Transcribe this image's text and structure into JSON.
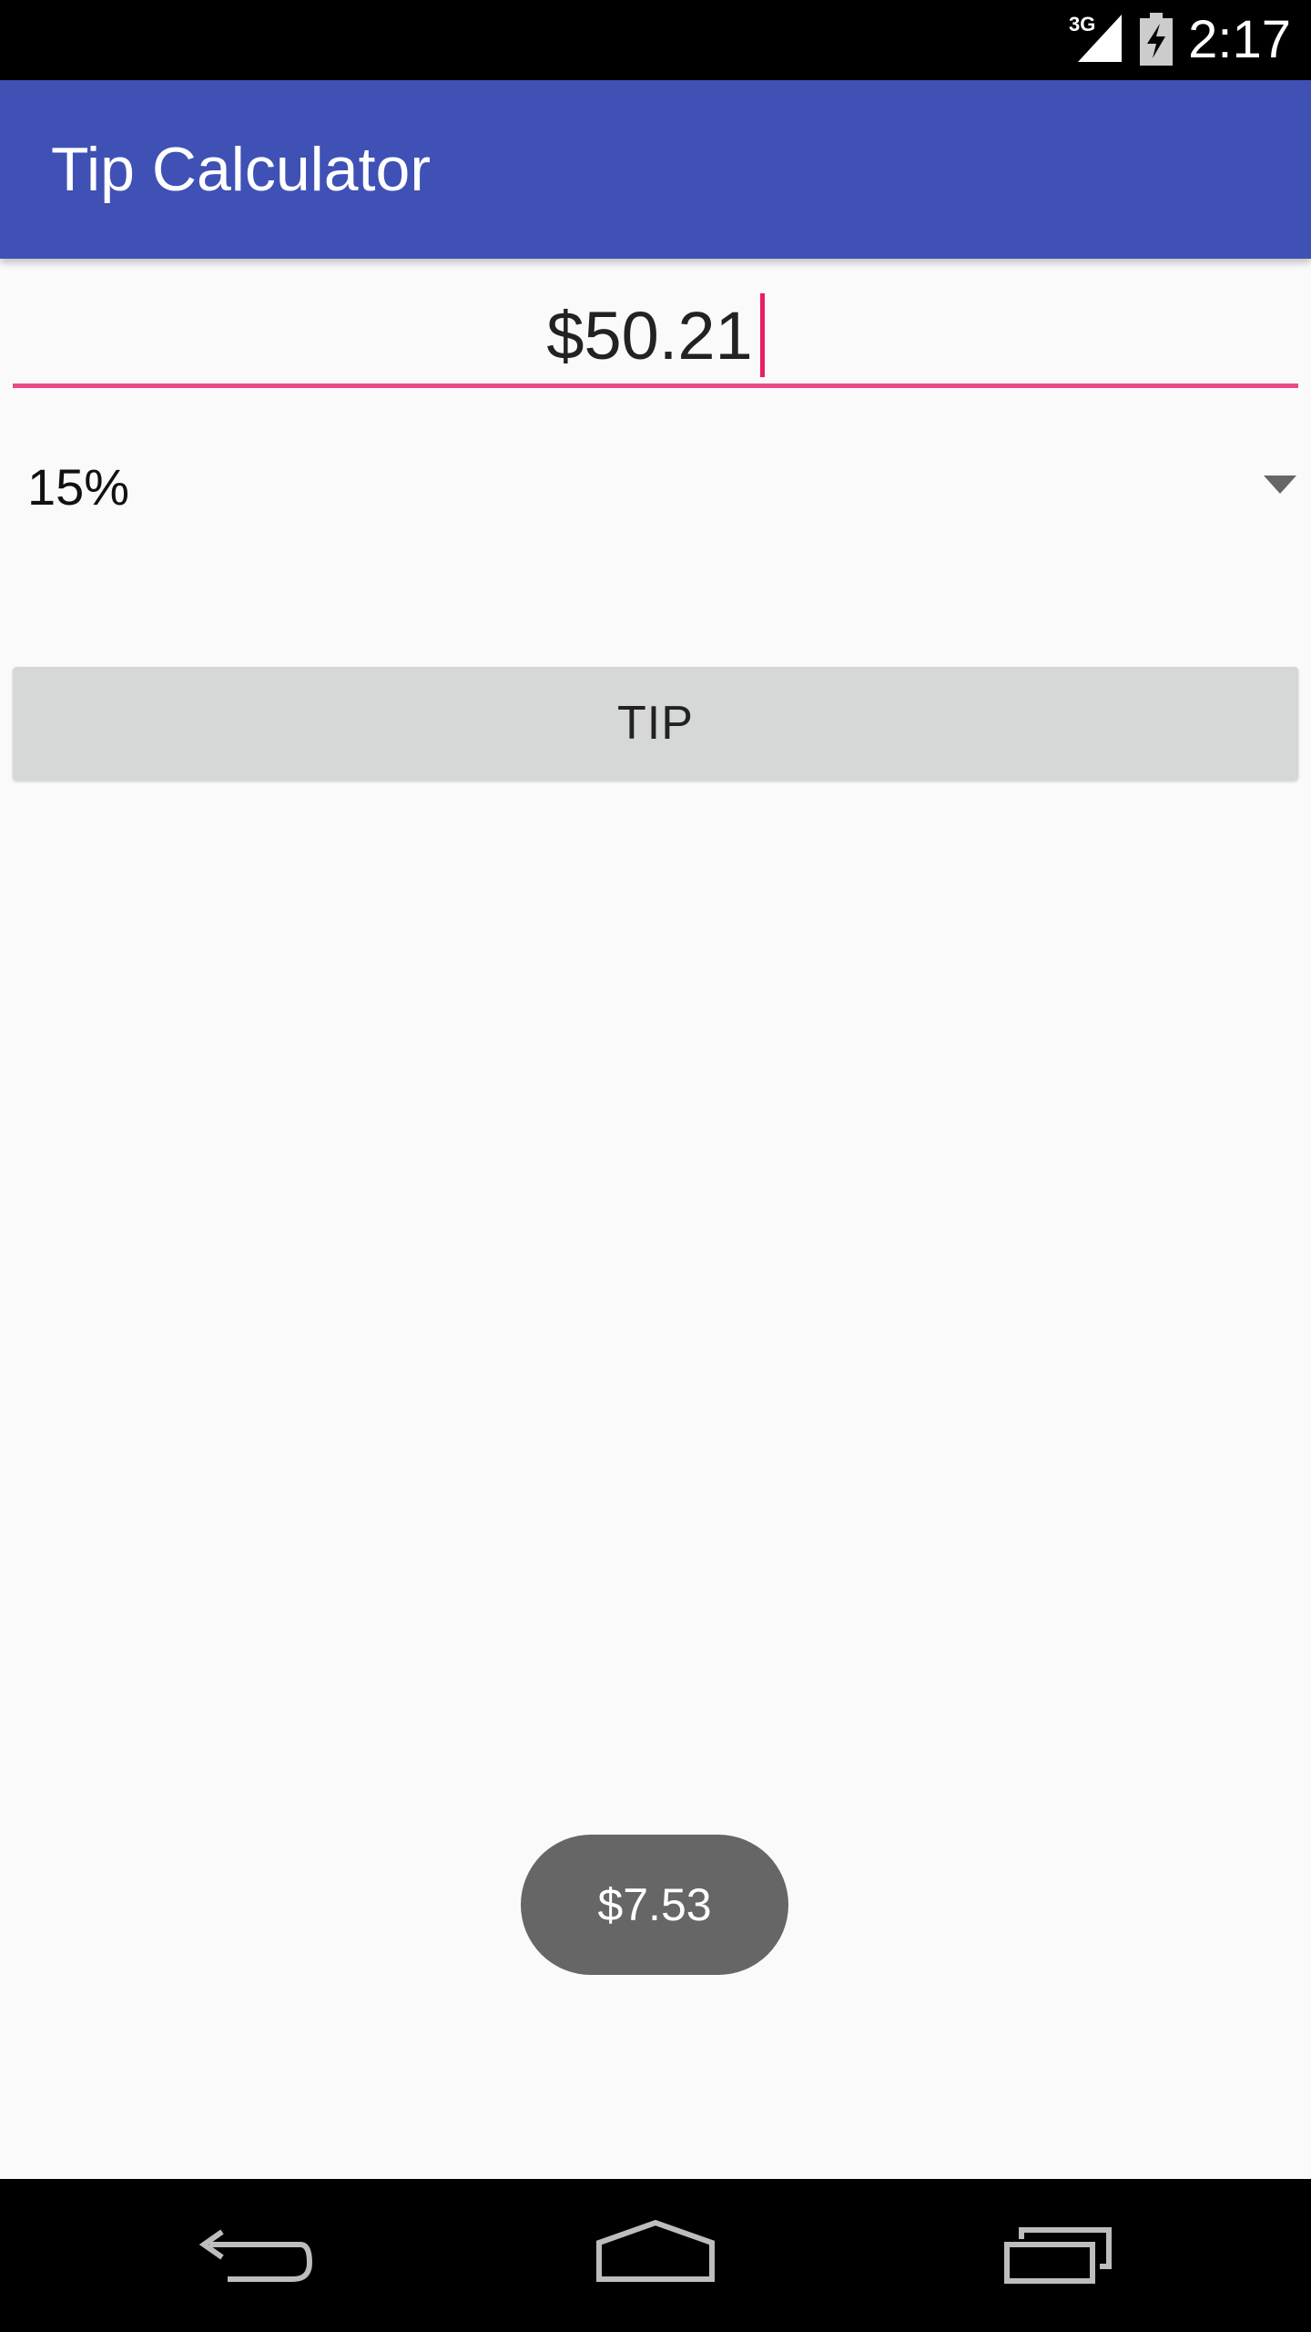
{
  "status_bar": {
    "network": "3G",
    "time": "2:17"
  },
  "app_bar": {
    "title": "Tip Calculator"
  },
  "bill_amount": {
    "value": "$50.21"
  },
  "tip_percent": {
    "selected": "15%"
  },
  "tip_button": {
    "label": "TIP"
  },
  "toast": {
    "text": "$7.53"
  },
  "colors": {
    "app_bar": "#3f51b5",
    "accent": "#e94b87",
    "button": "#d6d7d7",
    "toast": "#666666"
  },
  "icons": {
    "status": [
      "signal-icon",
      "battery-charging-icon"
    ],
    "nav": [
      "back-icon",
      "home-icon",
      "recents-icon"
    ]
  }
}
